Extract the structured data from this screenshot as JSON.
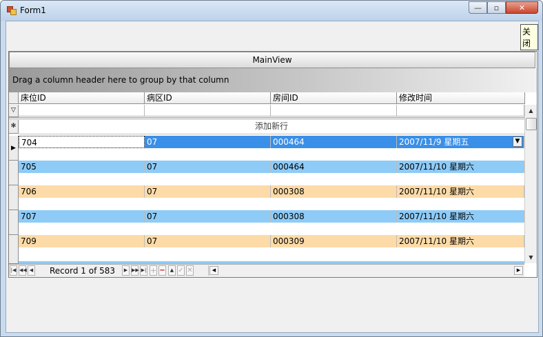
{
  "window": {
    "title": "Form1",
    "min_glyph": "—",
    "max_glyph": "▫",
    "close_glyph": "✕",
    "tooltip": "关闭"
  },
  "grid": {
    "view_caption": "MainView",
    "group_panel_text": "Drag a column header here to group by that column",
    "columns": [
      "床位ID",
      "病区ID",
      "房间ID",
      "修改时间"
    ],
    "new_row_text": "添加新行",
    "rows": [
      {
        "bed": "704",
        "ward": "07",
        "room": "000464",
        "modified": "2007/11/9 星期五",
        "style": "selected"
      },
      {
        "bed": "705",
        "ward": "07",
        "room": "000464",
        "modified": "2007/11/10 星期六",
        "style": "blue"
      },
      {
        "bed": "706",
        "ward": "07",
        "room": "000308",
        "modified": "2007/11/10 星期六",
        "style": "orange"
      },
      {
        "bed": "707",
        "ward": "07",
        "room": "000308",
        "modified": "2007/11/10 星期六",
        "style": "blue"
      },
      {
        "bed": "709",
        "ward": "07",
        "room": "000309",
        "modified": "2007/11/10 星期六",
        "style": "orange"
      }
    ]
  },
  "navigator": {
    "record_text": "Record 1 of 583"
  },
  "colors": {
    "row_blue": "#8ecbf7",
    "row_orange": "#fcdba8",
    "row_selected": "#3a8fe8"
  }
}
